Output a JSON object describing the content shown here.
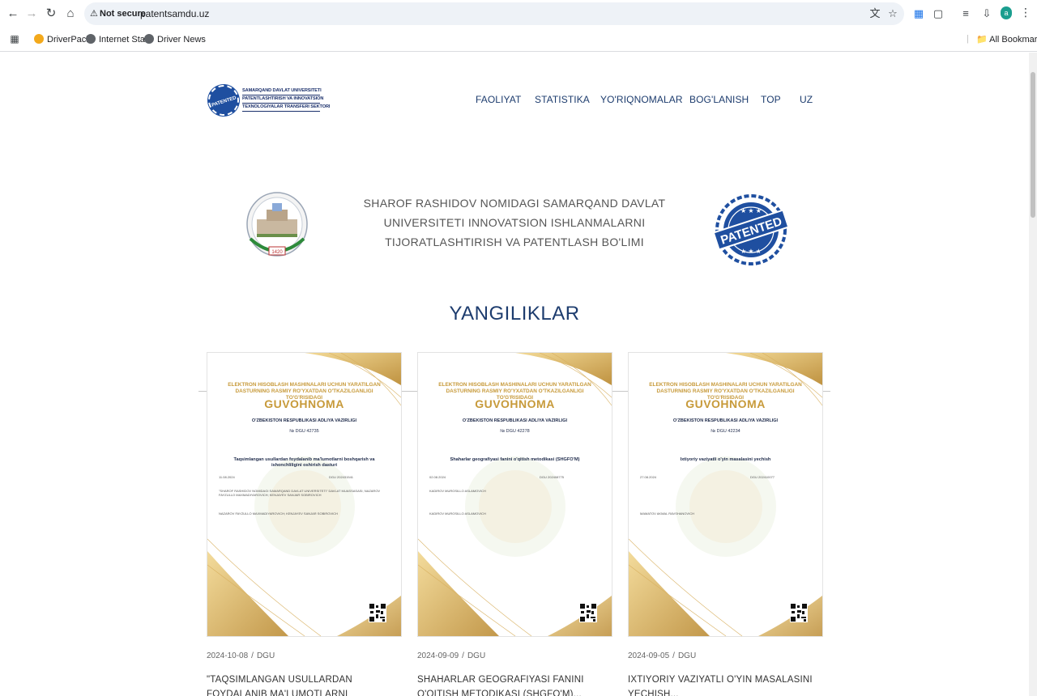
{
  "browser": {
    "security_status": "Not secure",
    "url": "patentsamdu.uz",
    "avatar_letter": "a",
    "bookmarks": [
      {
        "label": "DriverPack"
      },
      {
        "label": "Internet Start"
      },
      {
        "label": "Driver News"
      }
    ],
    "all_bookmarks": "All Bookmarks"
  },
  "site": {
    "logo": {
      "seal_text": "PATENTED",
      "lines": [
        "SAMARQAND DAVLAT UNIVERSITETI",
        "PATENTLASHTIRISH VA INNOVATSION",
        "TEXNOLOGIYALAR TRANSFERI SEKTORI"
      ]
    },
    "nav": [
      "FAOLIYAT",
      "STATISTIKA",
      "YO'RIQNOMALAR",
      "BOG'LANISH",
      "TOP",
      "UZ"
    ],
    "intro": {
      "title_lines": [
        "SHAROF RASHIDOV NOMIDAGI SAMARQAND DAVLAT",
        "UNIVERSITETI INNOVATSION ISHLANMALARNI",
        "TIJORATLASHTIRISH VA PATENTLASH BO'LIMI"
      ],
      "emblem_year": "1420",
      "stamp_text": "PATENTED"
    },
    "news_title": "YANGILIKLAR",
    "cards": [
      {
        "cert": {
          "head": "ELEKTRON HISOBLASH MASHINALARI UCHUN YARATILGAN DASTURNING RASMIY RO'YXATDAN O'TKAZILGANLIGI TO'G'RISIDAGI",
          "title": "GUVOHNOMA",
          "ministry": "O'ZBEKISTON RESPUBLIKASI ADLIYA VAZIRLIGI",
          "number": "№ DGU 42735",
          "program": "Taqsimlangan usullardan foydalanib ma'lumotlarni boshqarish va ishonchliligini oshirish dasturi",
          "date": "11.08.2024",
          "reg": "DGU 202431541",
          "owner": "\"SHAROF RASHIDOV NOMIDAGI SAMARQAND DAVLAT UNIVERSITETI\" DAVLAT MUASSASASI; NAZAROV FAYZULLO MAXMADIYAROVICH; KENJAYEV SANJAR SOBIROVICH",
          "authors": "NAZAROV FAYZULLO MAXMADIYAROVICH; KENJAYEV SANJAR SOBIROVICH"
        },
        "date": "2024-10-08",
        "category": "DGU",
        "heading": "\"TAQSIMLANGAN USULLARDAN FOYDALANIB MA'LUMOTLARNI BOSHQARISH..."
      },
      {
        "cert": {
          "head": "ELEKTRON HISOBLASH MASHINALARI UCHUN YARATILGAN DASTURNING RASMIY RO'YXATDAN O'TKAZILGANLIGI TO'G'RISIDAGI",
          "title": "GUVOHNOMA",
          "ministry": "O'ZBEKISTON RESPUBLIKASI ADLIYA VAZIRLIGI",
          "number": "№ DGU 42278",
          "program": "Shaharlar geografiyasi fanini o'qitish metodikasi (SHGFO'M)",
          "date": "02.08.2024",
          "reg": "DGU 202408775",
          "owner": "KADIROV MUROSILLO ASLAMOVICH",
          "authors": "KADIROV MUROSILLO ASLAMOVICH"
        },
        "date": "2024-09-09",
        "category": "DGU",
        "heading": "SHAHARLAR GEOGRAFIYASI FANINI O'QITISH METODIKASI (SHGFO'M)..."
      },
      {
        "cert": {
          "head": "ELEKTRON HISOBLASH MASHINALARI UCHUN YARATILGAN DASTURNING RASMIY RO'YXATDAN O'TKAZILGANLIGI TO'G'RISIDAGI",
          "title": "GUVOHNOMA",
          "ministry": "O'ZBEKISTON RESPUBLIKASI ADLIYA VAZIRLIGI",
          "number": "№ DGU 42234",
          "program": "Ixtiyoriy vaziyatli o'yin masalasini yechish",
          "date": "27.08.2024",
          "reg": "DGU 202410077",
          "owner": "",
          "authors": "MAMATOV AKMAL RAVSHANOVICH"
        },
        "date": "2024-09-05",
        "category": "DGU",
        "heading": "IXTIYORIY VAZIYATLI O'YIN MASALASINI YECHISH..."
      }
    ]
  },
  "colors": {
    "nav": "#1d3c6e",
    "gold": "#c79a3a",
    "brand_blue": "#1f4fa0"
  }
}
